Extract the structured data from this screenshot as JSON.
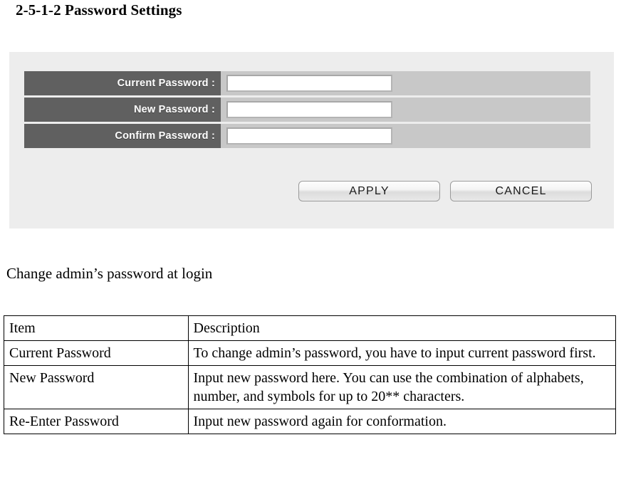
{
  "page": {
    "title": "2-5-1-2 Password Settings",
    "caption": "Change admin’s password at login"
  },
  "panel": {
    "colors": {
      "panel_background": "#ededed",
      "label_cell": "#606060",
      "field_cell": "#c8c8c8",
      "label_text": "#ffffff",
      "input_background": "#ffffff"
    },
    "fields": [
      {
        "label": "Current Password :",
        "value": "",
        "placeholder": ""
      },
      {
        "label": "New Password :",
        "value": "",
        "placeholder": ""
      },
      {
        "label": "Confirm Password :",
        "value": "",
        "placeholder": ""
      }
    ],
    "buttons": {
      "apply": "APPLY",
      "cancel": "CANCEL"
    }
  },
  "table": {
    "headers": [
      "Item",
      "Description"
    ],
    "rows": [
      {
        "item": "Current Password",
        "description": "To change admin’s password, you have to input current password first."
      },
      {
        "item": "New Password",
        "description": "Input new password here. You can use the combination of alphabets, number, and symbols for up to 20** characters."
      },
      {
        "item": "Re-Enter Password",
        "description": "Input new password again for conformation."
      }
    ]
  }
}
